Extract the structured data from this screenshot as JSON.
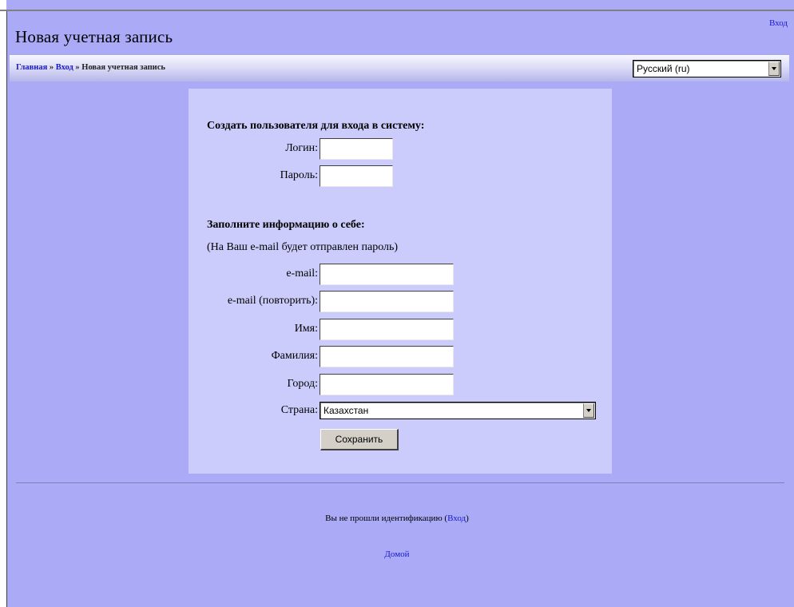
{
  "header": {
    "title": "Новая учетная запись",
    "login_link": "Вход"
  },
  "breadcrumb": {
    "home": "Главная",
    "sep1": " » ",
    "login": "Вход",
    "sep2": " » ",
    "current": "Новая учетная запись"
  },
  "language": {
    "selected": "Русский (ru)"
  },
  "form": {
    "section1_title": "Создать пользователя для входа в систему:",
    "username_label": "Логин:",
    "password_label": "Пароль:",
    "section2_title": "Заполните информацию о себе:",
    "email_note": "(На Ваш e-mail будет отправлен пароль)",
    "email_label": "e-mail:",
    "email2_label": "e-mail (повторить):",
    "firstname_label": "Имя:",
    "lastname_label": "Фамилия:",
    "city_label": "Город:",
    "country_label": "Страна:",
    "country_value": "Казахстан",
    "save_label": "Сохранить"
  },
  "footer": {
    "status_text": "Вы не прошли идентификацию (",
    "status_link": "Вход",
    "status_close": ")",
    "home_link": "Домой"
  }
}
